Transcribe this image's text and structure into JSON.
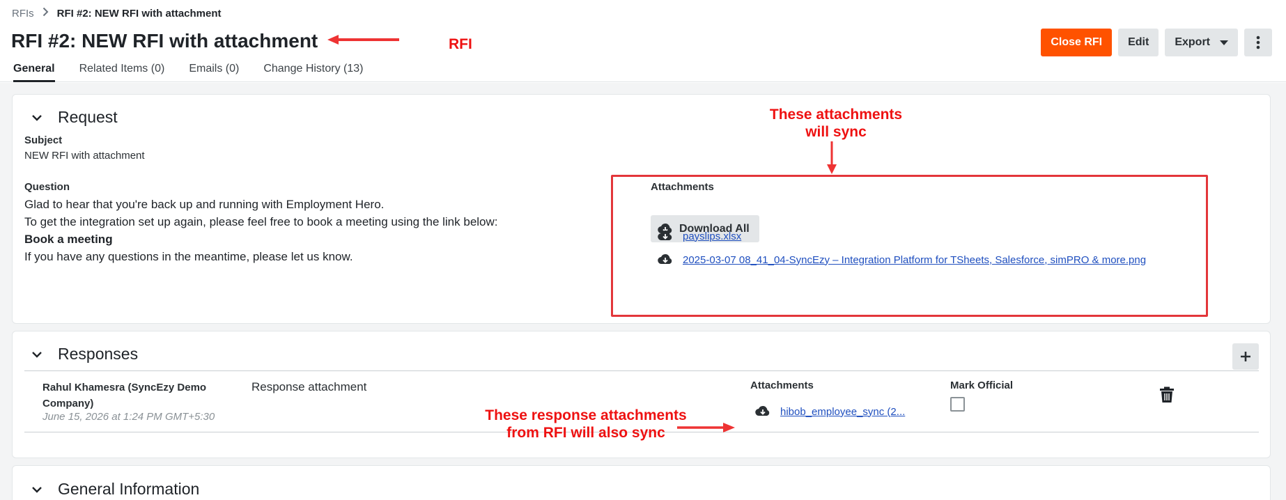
{
  "breadcrumb": {
    "root": "RFIs",
    "current": "RFI #2: NEW RFI with attachment"
  },
  "page_title": "RFI #2: NEW RFI with attachment",
  "tabs": [
    {
      "label": "General",
      "active": true
    },
    {
      "label": "Related Items (0)",
      "active": false
    },
    {
      "label": "Emails (0)",
      "active": false
    },
    {
      "label": "Change History (13)",
      "active": false
    }
  ],
  "toolbar": {
    "close_label": "Close RFI",
    "edit_label": "Edit",
    "export_label": "Export",
    "primary_color": "#ff5200"
  },
  "request": {
    "title": "Request",
    "subject_label": "Subject",
    "subject_value": "NEW RFI with attachment",
    "question_label": "Question",
    "question_lines": [
      "Glad to hear that you're back up and running with Employment Hero.",
      "To get the integration set up again, please feel free to book a meeting using the link below:",
      "Book a meeting",
      "If you have any questions in the meantime, please let us know."
    ],
    "attachments_label": "Attachments",
    "download_all_label": "Download All",
    "attachments": [
      "payslips.xlsx",
      "2025-03-07 08_41_04-SyncEzy – Integration Platform for TSheets, Salesforce, simPRO & more.png"
    ]
  },
  "responses": {
    "title": "Responses",
    "rows": [
      {
        "author_line1": "Rahul Khamesra (SyncEzy Demo",
        "author_line2": "Company)",
        "date": "June 15, 2026 at 1:24 PM GMT+5:30",
        "text": "Response attachment",
        "attachments_label": "Attachments",
        "attachment": "hibob_employee_sync (2...",
        "mark_official_label": "Mark Official",
        "official": false
      }
    ]
  },
  "general_information": {
    "title": "General Information"
  },
  "annotations": {
    "rfi": "RFI",
    "attachments_sync_line1": "These attachments",
    "attachments_sync_line2": "will sync",
    "responses_sync_line1": "These response attachments",
    "responses_sync_line2": "from RFI will also sync",
    "color": "#ee1111"
  }
}
